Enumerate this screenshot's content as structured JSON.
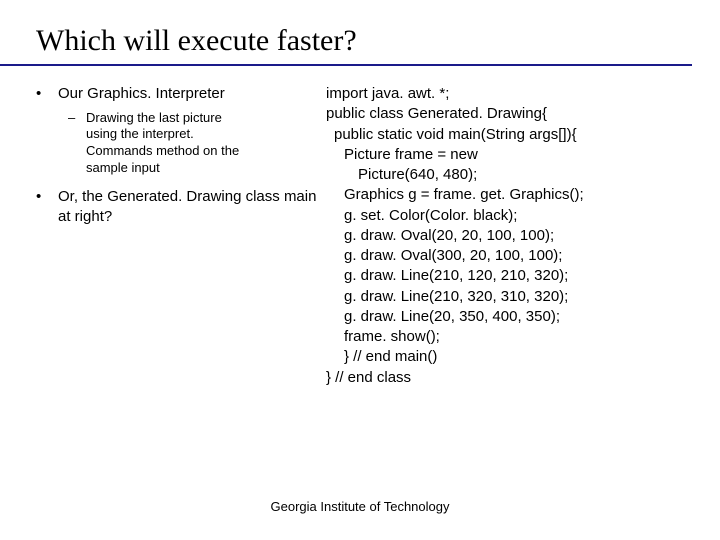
{
  "title": "Which will execute faster?",
  "left": {
    "b1": "Our Graphics. Interpreter",
    "sub1": "Drawing the last picture using the interpret. Commands method on the sample input",
    "b2": "Or, the Generated. Drawing class main at right?"
  },
  "code": {
    "l1": "import java. awt. *;",
    "l2": "public class Generated. Drawing{",
    "l3": "public static void main(String args[]){",
    "l4": "Picture frame = new",
    "l5": "Picture(640, 480);",
    "l6": "Graphics g = frame. get. Graphics();",
    "l7": "g. set. Color(Color. black);",
    "l8": "g. draw. Oval(20, 20, 100, 100);",
    "l9": "g. draw. Oval(300, 20, 100, 100);",
    "l10": "g. draw. Line(210, 120, 210, 320);",
    "l11": "g. draw. Line(210, 320, 310, 320);",
    "l12": "g. draw. Line(20, 350, 400, 350);",
    "l13": "frame. show();",
    "l14": "} // end main()",
    "l15": "} // end class"
  },
  "footer": "Georgia Institute of Technology"
}
